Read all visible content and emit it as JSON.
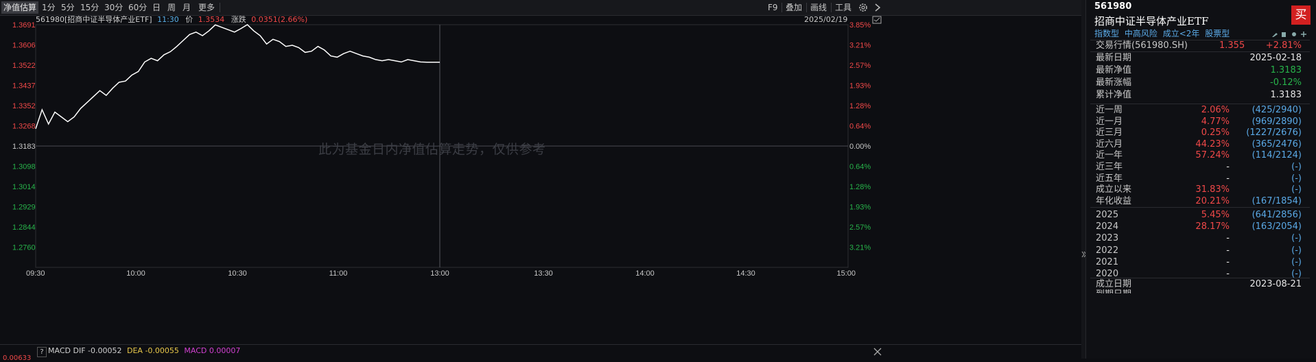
{
  "toolbar": {
    "tabs": [
      "净值估算",
      "1分",
      "5分",
      "15分",
      "30分",
      "60分",
      "日",
      "周",
      "月",
      "更多"
    ],
    "right": [
      "F9",
      "叠加",
      "画线",
      "工具"
    ]
  },
  "info_bar": {
    "code_name": "561980[招商中证半导体产业ETF]",
    "time": "11:30",
    "price_label": "价",
    "price": "1.3534",
    "change_label": "涨跌",
    "change": "0.0351(2.66%)",
    "date": "2025/02/19"
  },
  "watermark": "此为基金日内净值估算走势，仅供参考",
  "macd": {
    "help": "?",
    "label": "MACD",
    "dif_label": "DIF",
    "dif": "-0.00052",
    "dea_label": "DEA",
    "dea": "-0.00055",
    "macd_label": "MACD",
    "macd": "0.00007",
    "left_value": "0.00633"
  },
  "chart_data": {
    "type": "line",
    "x_ticks": [
      "09:30",
      "10:00",
      "10:30",
      "11:00",
      "13:00",
      "13:30",
      "14:00",
      "14:30",
      "15:00"
    ],
    "y_ticks_left": [
      "1.3691",
      "1.3606",
      "1.3522",
      "1.3437",
      "1.3352",
      "1.3268",
      "1.3183",
      "1.3098",
      "1.3014",
      "1.2929",
      "1.2844",
      "1.2760"
    ],
    "y_ticks_right": [
      "3.85%",
      "3.21%",
      "2.57%",
      "1.93%",
      "1.28%",
      "0.64%",
      "0.00%",
      "0.64%",
      "1.28%",
      "1.93%",
      "2.57%",
      "3.21%"
    ],
    "ylim": [
      1.2675,
      1.3691
    ],
    "base": 1.3183,
    "series": [
      {
        "values": [
          1.3255,
          1.3335,
          1.3275,
          1.3325,
          1.3305,
          1.3285,
          1.3305,
          1.334,
          1.3365,
          1.339,
          1.3415,
          1.3395,
          1.3425,
          1.345,
          1.3455,
          1.348,
          1.3495,
          1.3535,
          1.355,
          1.354,
          1.3565,
          1.3578,
          1.36,
          1.3625,
          1.365,
          1.366,
          1.3645,
          1.3665,
          1.369,
          1.368,
          1.367,
          1.366,
          1.3675,
          1.3691,
          1.3665,
          1.3645,
          1.361,
          1.363,
          1.362,
          1.36,
          1.3605,
          1.3595,
          1.3575,
          1.358,
          1.36,
          1.3585,
          1.356,
          1.3555,
          1.357,
          1.358,
          1.357,
          1.356,
          1.3555,
          1.3545,
          1.354,
          1.3545,
          1.354,
          1.3535,
          1.3545,
          1.354,
          1.3535,
          1.3534,
          1.3534,
          1.3534
        ]
      }
    ]
  },
  "side": {
    "code": "561980",
    "name": "招商中证半导体产业ETF",
    "buy": "买",
    "tags": [
      "指数型",
      "中高风险",
      "成立<2年",
      "股票型"
    ],
    "trade_label": "交易行情(561980.SH)",
    "trade_price": "1.355",
    "trade_change": "+2.81%",
    "latest_date_label": "最新日期",
    "latest_date": "2025-02-18",
    "nav_label": "最新净值",
    "nav": "1.3183",
    "nav_change_label": "最新涨幅",
    "nav_change": "-0.12%",
    "cum_label": "累计净值",
    "cum": "1.3183",
    "perf": [
      {
        "k": "近一周",
        "v": "2.06%",
        "r": "(425/2940)",
        "c": "red"
      },
      {
        "k": "近一月",
        "v": "4.77%",
        "r": "(969/2890)",
        "c": "red"
      },
      {
        "k": "近三月",
        "v": "0.25%",
        "r": "(1227/2676)",
        "c": "red"
      },
      {
        "k": "近六月",
        "v": "44.23%",
        "r": "(365/2476)",
        "c": "red"
      },
      {
        "k": "近一年",
        "v": "57.24%",
        "r": "(114/2124)",
        "c": "red"
      },
      {
        "k": "近三年",
        "v": "-",
        "r": "(-)",
        "c": "white"
      },
      {
        "k": "近五年",
        "v": "-",
        "r": "(-)",
        "c": "white"
      },
      {
        "k": "成立以来",
        "v": "31.83%",
        "r": "(-)",
        "c": "red"
      },
      {
        "k": "年化收益",
        "v": "20.21%",
        "r": "(167/1854)",
        "c": "red"
      }
    ],
    "years": [
      {
        "k": "2025",
        "v": "5.45%",
        "r": "(641/2856)",
        "c": "red"
      },
      {
        "k": "2024",
        "v": "28.17%",
        "r": "(163/2054)",
        "c": "red"
      },
      {
        "k": "2023",
        "v": "-",
        "r": "(-)",
        "c": "white"
      },
      {
        "k": "2022",
        "v": "-",
        "r": "(-)",
        "c": "white"
      },
      {
        "k": "2021",
        "v": "-",
        "r": "(-)",
        "c": "white"
      },
      {
        "k": "2020",
        "v": "-",
        "r": "(-)",
        "c": "white"
      }
    ],
    "inception_label": "成立日期",
    "inception": "2023-08-21",
    "more_label": "到期日期"
  }
}
